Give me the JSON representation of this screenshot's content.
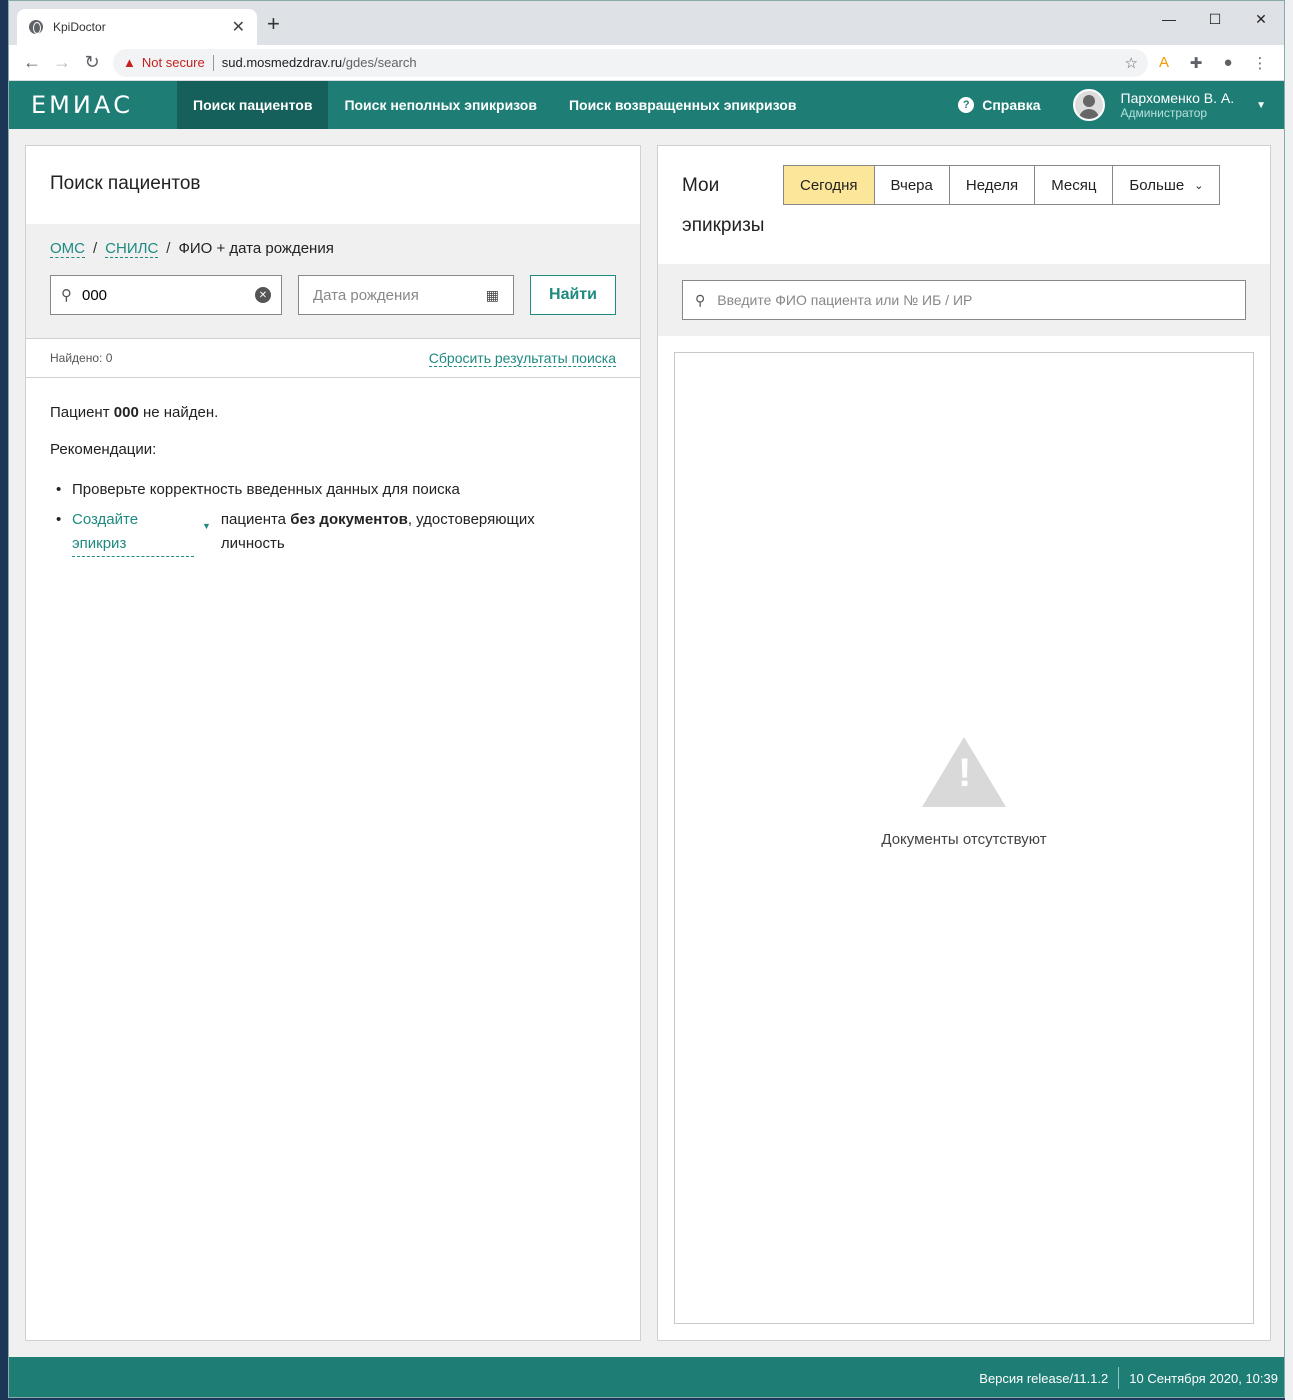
{
  "browser": {
    "tab_title": "KpiDoctor",
    "new_tab": "+",
    "security_label": "Not secure",
    "url_host": "sud.mosmedzdrav.ru",
    "url_path": "/gdes/search"
  },
  "app": {
    "logo": "ЕМИАС",
    "nav": [
      "Поиск пациентов",
      "Поиск неполных эпикризов",
      "Поиск возвращенных эпикризов"
    ],
    "help": "Справка",
    "user_name": "Пархоменко В. А.",
    "user_role": "Администратор"
  },
  "left": {
    "title": "Поиск пациентов",
    "crumb_oms": "ОМС",
    "crumb_snils": "СНИЛС",
    "crumb_current": "ФИО + дата рождения",
    "fio_value": "000",
    "date_placeholder": "Дата рождения",
    "find_button": "Найти",
    "found": "Найдено: 0",
    "reset_link": "Сбросить результаты поиска",
    "not_found_prefix": "Пациент ",
    "not_found_query": "000",
    "not_found_suffix": " не найден.",
    "recommendations": "Рекомендации:",
    "rec1": "Проверьте корректность введенных данных для поиска",
    "create_link": "Создайте эпикриз",
    "rec2_part1": "пациента ",
    "rec2_bold": "без документов",
    "rec2_part2": ", удостоверяющих личность"
  },
  "right": {
    "title": "Мои эпикризы",
    "periods": [
      "Сегодня",
      "Вчера",
      "Неделя",
      "Месяц",
      "Больше"
    ],
    "selected_period": "Сегодня",
    "search_placeholder": "Введите ФИО пациента или № ИБ / ИР",
    "empty_text": "Документы отсутствуют"
  },
  "footer": {
    "version": "Версия release/11.1.2",
    "datetime": "10 Сентября 2020, 10:39"
  },
  "colors": {
    "accent": "#1e7e76",
    "link": "#1e8a80",
    "selected_period": "#fbe69a"
  }
}
